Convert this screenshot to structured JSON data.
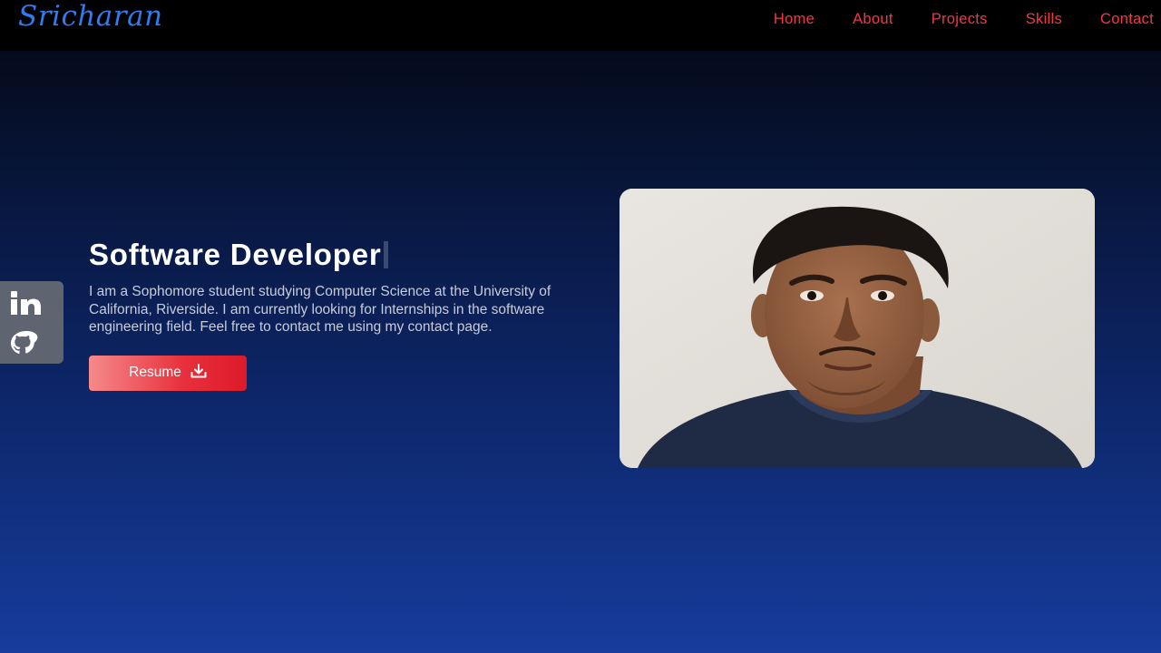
{
  "brand": {
    "name": "Sricharan"
  },
  "nav": {
    "items": [
      {
        "label": "Home"
      },
      {
        "label": "About"
      },
      {
        "label": "Projects"
      },
      {
        "label": "Skills"
      },
      {
        "label": "Contact"
      }
    ]
  },
  "hero": {
    "title": "Software Developer",
    "description": "I am a Sophomore student studying Computer Science at the University of California, Riverside. I am currently looking for Internships in the software engineering field. Feel free to contact me using my contact page.",
    "resume_label": "Resume",
    "resume_icon": "download-icon"
  },
  "social": {
    "items": [
      {
        "icon": "linkedin-icon"
      },
      {
        "icon": "github-icon"
      }
    ]
  },
  "photo": {
    "subject": "portrait-photo"
  },
  "colors": {
    "logo": "#2f7bf0",
    "nav_link": "#f03848",
    "button_start": "#f58a8a",
    "button_end": "#dd1a2a",
    "bg_top": "#03060e",
    "bg_bottom": "#163c9c"
  }
}
